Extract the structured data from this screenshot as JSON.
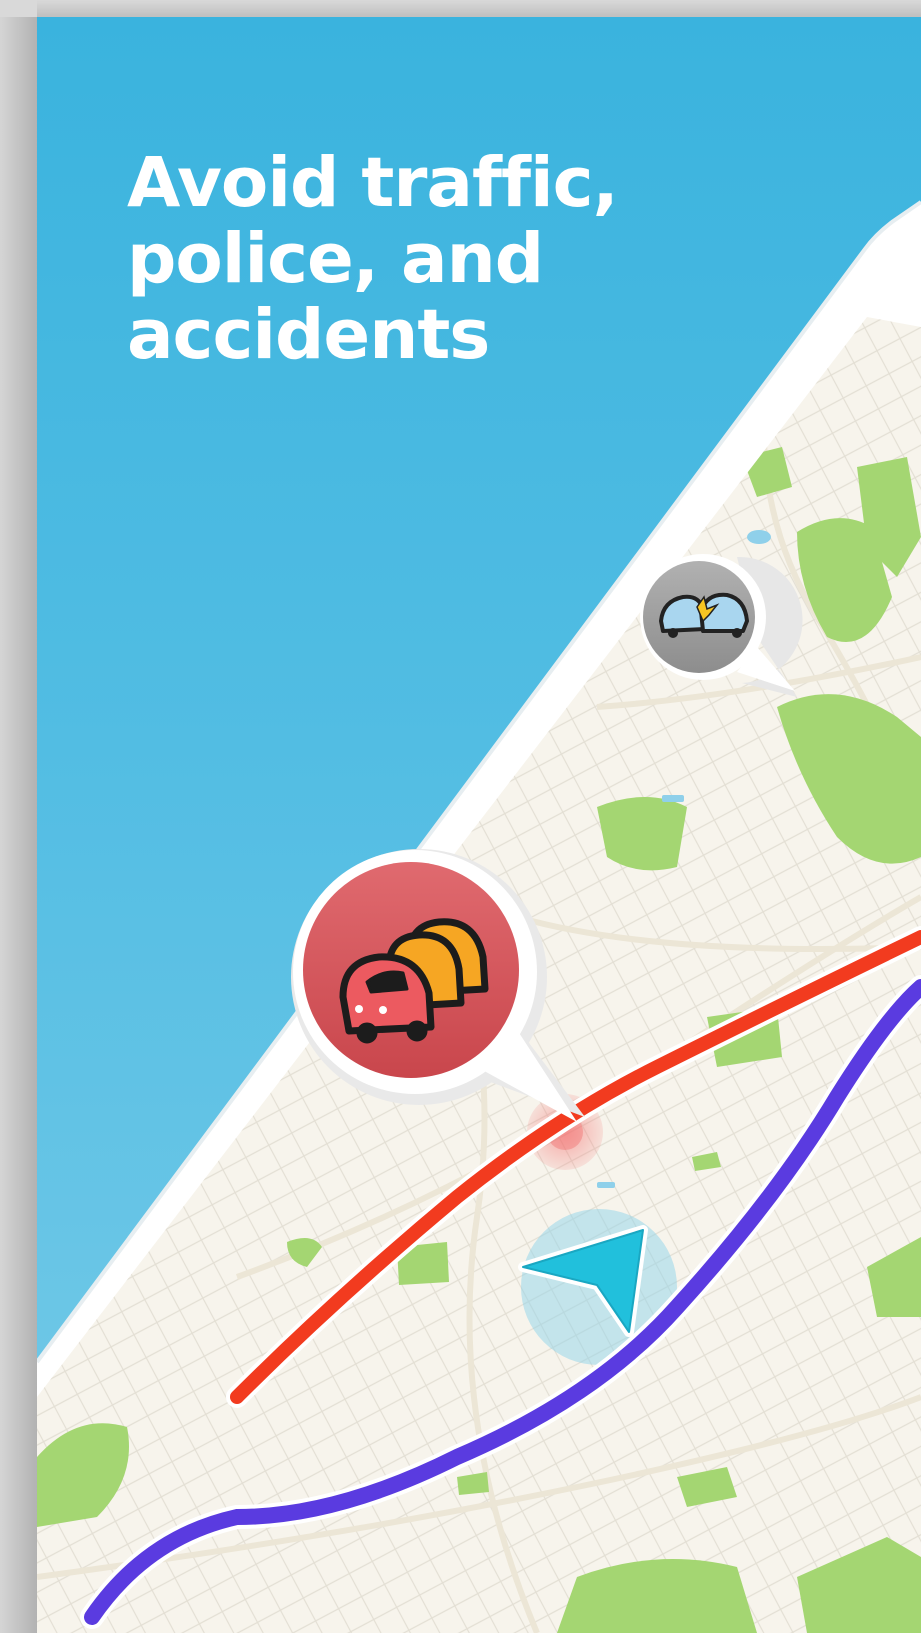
{
  "headline": {
    "line1": "Avoid traffic,",
    "line2": "police, and",
    "line3": "accidents"
  },
  "icons": {
    "accident_pin": "car-crash-icon",
    "traffic_pin": "traffic-jam-icon",
    "user_position": "navigation-arrow-icon"
  },
  "colors": {
    "background": "#3ab3de",
    "headline_text": "#ffffff",
    "route_primary": "#5a3be0",
    "route_alternate": "#f23b1f",
    "traffic_pin": "#d9585c",
    "accident_pin": "#9a9a9a",
    "position_marker": "#21c0dc"
  }
}
